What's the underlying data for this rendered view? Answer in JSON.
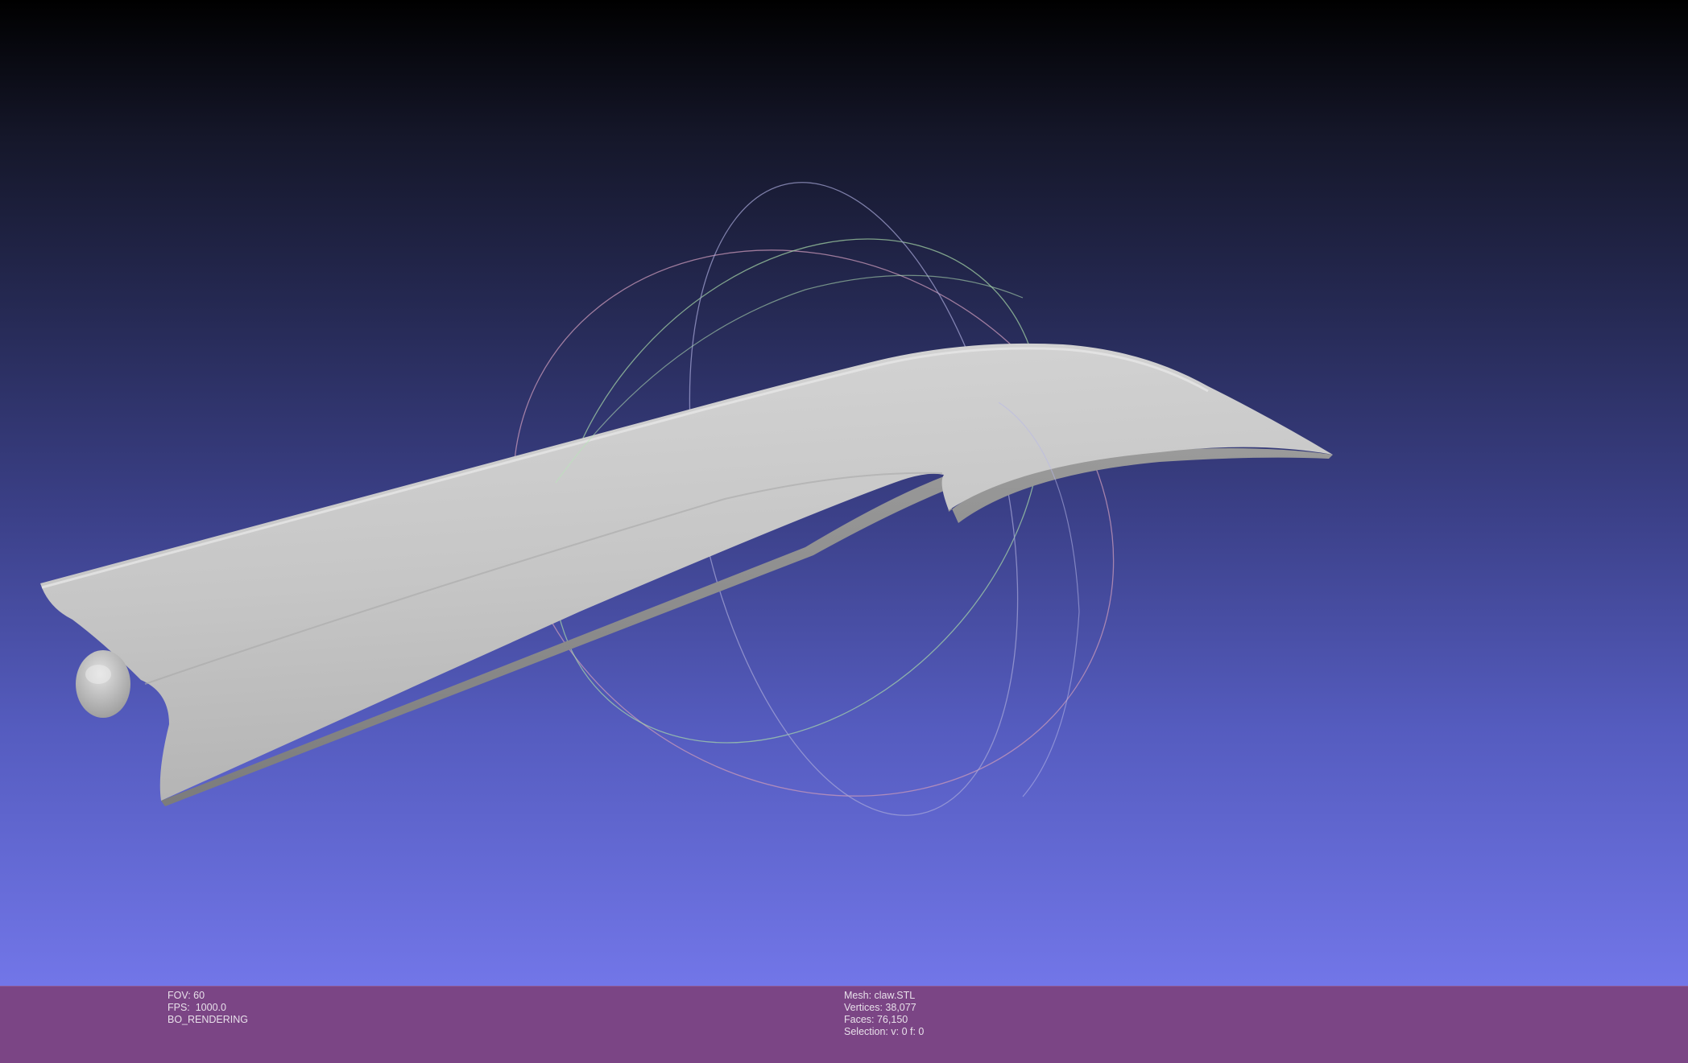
{
  "viewer": {
    "colors": {
      "background_top": "#000000",
      "background_bottom": "#7276e8",
      "status_bar": "#7b4585",
      "mesh": "#c8c8c8",
      "trackball_x": "#e08080",
      "trackball_y": "#80e080",
      "trackball_z": "#8080e0"
    }
  },
  "status": {
    "left": {
      "fov": "FOV: 60",
      "fps": "FPS:  1000.0",
      "render_mode": "BO_RENDERING"
    },
    "right": {
      "mesh": "Mesh: claw.STL",
      "vertices": "Vertices: 38,077",
      "faces": "Faces: 76,150",
      "selection": "Selection: v: 0 f: 0"
    }
  }
}
